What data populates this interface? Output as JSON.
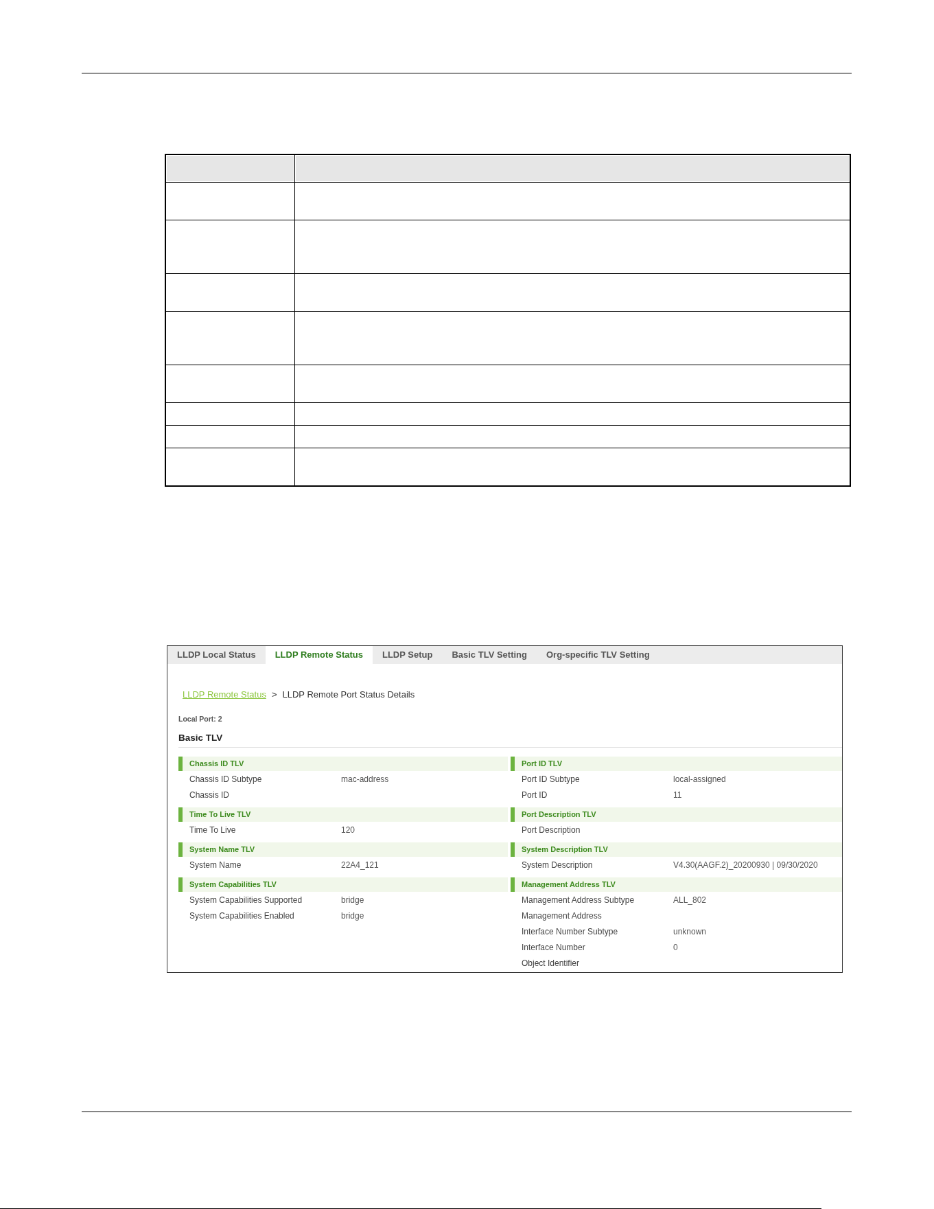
{
  "table": {
    "rows": [
      {
        "kind": "header"
      },
      {
        "kind": "double"
      },
      {
        "kind": "triple"
      },
      {
        "kind": "double"
      },
      {
        "kind": "triple"
      },
      {
        "kind": "double"
      },
      {
        "kind": "single"
      },
      {
        "kind": "single"
      },
      {
        "kind": "double"
      }
    ]
  },
  "screen": {
    "tabs": [
      {
        "label": "LLDP Local Status",
        "selected": false
      },
      {
        "label": "LLDP Remote Status",
        "selected": true
      },
      {
        "label": "LLDP Setup",
        "selected": false
      },
      {
        "label": "Basic TLV Setting",
        "selected": false
      },
      {
        "label": "Org-specific TLV Setting",
        "selected": false
      }
    ],
    "breadcrumb": {
      "link": "LLDP Remote Status",
      "separator": ">",
      "current": "LLDP Remote Port Status Details"
    },
    "local_port": "Local Port: 2",
    "section_title": "Basic TLV",
    "columns": [
      {
        "sections": [
          {
            "title": "Chassis ID TLV",
            "fields": [
              {
                "label": "Chassis ID Subtype",
                "value": "mac-address"
              },
              {
                "label": "Chassis ID"
              }
            ]
          },
          {
            "title": "Time To Live TLV",
            "fields": [
              {
                "label": "Time To Live",
                "value": "120"
              }
            ]
          },
          {
            "title": "System Name TLV",
            "fields": [
              {
                "label": "System Name",
                "value": "22A4_121"
              }
            ]
          },
          {
            "title": "System Capabilities TLV",
            "fields": [
              {
                "label": "System Capabilities Supported",
                "value": "bridge"
              },
              {
                "label": "System Capabilities Enabled",
                "value": "bridge"
              }
            ]
          }
        ]
      },
      {
        "sections": [
          {
            "title": "Port ID TLV",
            "fields": [
              {
                "label": "Port ID Subtype",
                "value": "local-assigned"
              },
              {
                "label": "Port ID",
                "value": "11"
              }
            ]
          },
          {
            "title": "Port Description TLV",
            "fields": [
              {
                "label": "Port Description"
              }
            ]
          },
          {
            "title": "System Description TLV",
            "fields": [
              {
                "label": "System Description",
                "value": "V4.30(AAGF.2)_20200930 | 09/30/2020"
              }
            ]
          },
          {
            "title": "Management Address TLV",
            "fields": [
              {
                "label": "Management Address Subtype",
                "value": "ALL_802"
              },
              {
                "label": "Management Address"
              },
              {
                "label": "Interface Number Subtype",
                "value": "unknown"
              },
              {
                "label": "Interface Number",
                "value": "0"
              },
              {
                "label": "Object Identifier"
              }
            ]
          }
        ]
      }
    ]
  }
}
